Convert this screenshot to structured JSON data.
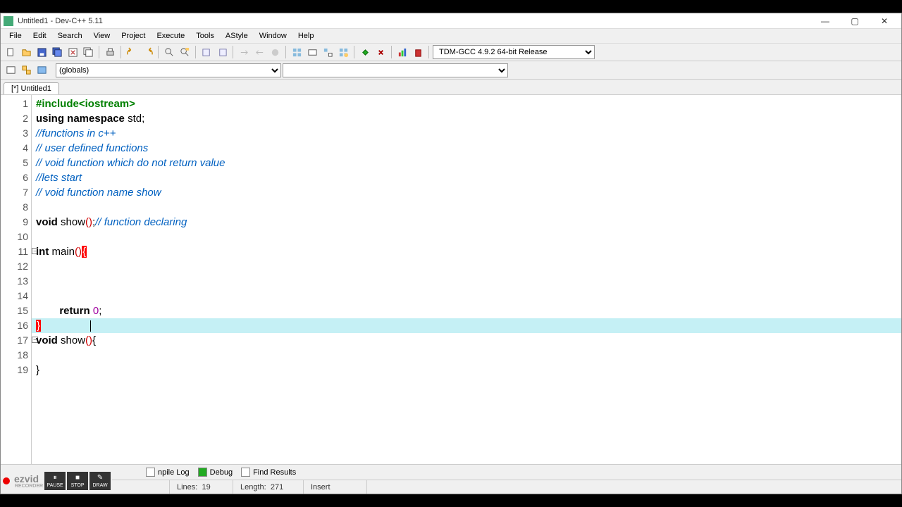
{
  "window": {
    "title": "Untitled1 - Dev-C++ 5.11"
  },
  "menu": [
    "File",
    "Edit",
    "Search",
    "View",
    "Project",
    "Execute",
    "Tools",
    "AStyle",
    "Window",
    "Help"
  ],
  "toolbar": {
    "compiler_select": "TDM-GCC 4.9.2 64-bit Release"
  },
  "toolbar2": {
    "scope": "(globals)",
    "symbol": ""
  },
  "tabs": {
    "active": "[*] Untitled1"
  },
  "code": {
    "lines": [
      {
        "n": 1,
        "tokens": [
          [
            "pp",
            "#include"
          ],
          [
            "pp",
            "<iostream>"
          ]
        ]
      },
      {
        "n": 2,
        "tokens": [
          [
            "kw",
            "using namespace"
          ],
          [
            "",
            " "
          ],
          [
            "fn",
            "std"
          ],
          [
            "",
            ";"
          ]
        ]
      },
      {
        "n": 3,
        "tokens": [
          [
            "cm",
            "//functions in c++"
          ]
        ]
      },
      {
        "n": 4,
        "tokens": [
          [
            "cm",
            "// user defined functions"
          ]
        ]
      },
      {
        "n": 5,
        "tokens": [
          [
            "cm",
            "// void function which do not return value"
          ]
        ]
      },
      {
        "n": 6,
        "tokens": [
          [
            "cm",
            "//lets start"
          ]
        ]
      },
      {
        "n": 7,
        "tokens": [
          [
            "cm",
            "// void function name show"
          ]
        ]
      },
      {
        "n": 8,
        "tokens": []
      },
      {
        "n": 9,
        "tokens": [
          [
            "kw",
            "void"
          ],
          [
            "",
            " "
          ],
          [
            "fn",
            "show"
          ],
          [
            "paren",
            "()"
          ],
          [
            "",
            ";"
          ],
          [
            "cm",
            "// function declaring"
          ]
        ]
      },
      {
        "n": 10,
        "tokens": []
      },
      {
        "n": 11,
        "fold": true,
        "tokens": [
          [
            "kw",
            "int"
          ],
          [
            "",
            " "
          ],
          [
            "fn",
            "main"
          ],
          [
            "paren",
            "()"
          ],
          [
            "brace-match",
            "{"
          ]
        ]
      },
      {
        "n": 12,
        "tokens": [
          [
            "",
            "\t"
          ]
        ]
      },
      {
        "n": 13,
        "tokens": [
          [
            "",
            "\t"
          ]
        ]
      },
      {
        "n": 14,
        "tokens": [
          [
            "",
            "\t"
          ]
        ]
      },
      {
        "n": 15,
        "tokens": [
          [
            "",
            "\t"
          ],
          [
            "kw",
            "return"
          ],
          [
            "",
            " "
          ],
          [
            "num",
            "0"
          ],
          [
            "",
            ";"
          ]
        ]
      },
      {
        "n": 16,
        "hl": true,
        "tokens": [
          [
            "brace-match",
            "}"
          ]
        ],
        "cursor_after": true
      },
      {
        "n": 17,
        "fold": true,
        "tokens": [
          [
            "kw",
            "void"
          ],
          [
            "",
            " "
          ],
          [
            "fn",
            "show"
          ],
          [
            "paren",
            "()"
          ],
          [
            "",
            "{"
          ]
        ]
      },
      {
        "n": 18,
        "tokens": [
          [
            "",
            "\t"
          ]
        ]
      },
      {
        "n": 19,
        "tokens": [
          [
            "",
            "}"
          ]
        ]
      }
    ]
  },
  "bottom_tabs": {
    "compile_log": "npile Log",
    "debug": "Debug",
    "find_results": "Find Results"
  },
  "statusbar": {
    "lines_label": "Lines:",
    "lines_val": "19",
    "length_label": "Length:",
    "length_val": "271",
    "insert": "Insert"
  },
  "recorder": {
    "brand": "ezvid",
    "sub": "RECORDER",
    "pause": "PAUSE",
    "stop": "STOP",
    "draw": "DRAW"
  }
}
